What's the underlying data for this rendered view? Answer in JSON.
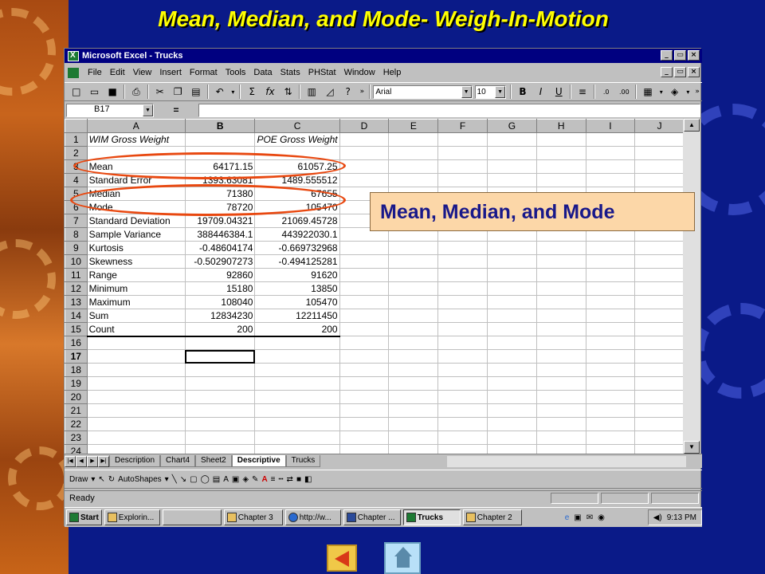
{
  "slide": {
    "title": "Mean, Median, and Mode- Weigh-In-Motion",
    "callout_text": "Mean, Median, and Mode"
  },
  "window": {
    "title": "Microsoft Excel - Trucks",
    "controls": [
      "_",
      "▭",
      "×"
    ]
  },
  "menu": {
    "items": [
      "File",
      "Edit",
      "View",
      "Insert",
      "Format",
      "Tools",
      "Data",
      "Stats",
      "PHStat",
      "Window",
      "Help"
    ]
  },
  "toolbar": {
    "font_name": "Arial",
    "font_size": "10"
  },
  "formula_bar": {
    "cell_ref": "B17",
    "equals": "=",
    "value": ""
  },
  "sheet": {
    "columns": [
      "A",
      "B",
      "C",
      "D",
      "E",
      "F",
      "G",
      "H",
      "I",
      "J"
    ],
    "header_row": [
      "WIM Gross Weight",
      "",
      "POE Gross Weight"
    ],
    "rows": [
      {
        "n": "1",
        "a": "WIM Gross Weight",
        "b": "",
        "c": "POE Gross Weight"
      },
      {
        "n": "2",
        "a": "",
        "b": "",
        "c": ""
      },
      {
        "n": "3",
        "a": "Mean",
        "b": "64171.15",
        "c": "61057.25"
      },
      {
        "n": "4",
        "a": "Standard Error",
        "b": "1393.63081",
        "c": "1489.555512"
      },
      {
        "n": "5",
        "a": "Median",
        "b": "71380",
        "c": "67655"
      },
      {
        "n": "6",
        "a": "Mode",
        "b": "78720",
        "c": "105470"
      },
      {
        "n": "7",
        "a": "Standard Deviation",
        "b": "19709.04321",
        "c": "21069.45728"
      },
      {
        "n": "8",
        "a": "Sample Variance",
        "b": "388446384.1",
        "c": "443922030.1"
      },
      {
        "n": "9",
        "a": "Kurtosis",
        "b": "-0.48604174",
        "c": "-0.669732968"
      },
      {
        "n": "10",
        "a": "Skewness",
        "b": "-0.502907273",
        "c": "-0.494125281"
      },
      {
        "n": "11",
        "a": "Range",
        "b": "92860",
        "c": "91620"
      },
      {
        "n": "12",
        "a": "Minimum",
        "b": "15180",
        "c": "13850"
      },
      {
        "n": "13",
        "a": "Maximum",
        "b": "108040",
        "c": "105470"
      },
      {
        "n": "14",
        "a": "Sum",
        "b": "12834230",
        "c": "12211450"
      },
      {
        "n": "15",
        "a": "Count",
        "b": "200",
        "c": "200"
      },
      {
        "n": "16",
        "a": "",
        "b": "",
        "c": ""
      },
      {
        "n": "17",
        "a": "",
        "b": "",
        "c": ""
      },
      {
        "n": "18",
        "a": "",
        "b": "",
        "c": ""
      },
      {
        "n": "19",
        "a": "",
        "b": "",
        "c": ""
      },
      {
        "n": "20",
        "a": "",
        "b": "",
        "c": ""
      },
      {
        "n": "21",
        "a": "",
        "b": "",
        "c": ""
      },
      {
        "n": "22",
        "a": "",
        "b": "",
        "c": ""
      },
      {
        "n": "23",
        "a": "",
        "b": "",
        "c": ""
      },
      {
        "n": "24",
        "a": "",
        "b": "",
        "c": ""
      }
    ],
    "tabs": [
      "Description",
      "Chart4",
      "Sheet2",
      "Descriptive",
      "Trucks"
    ],
    "active_tab": "Descriptive"
  },
  "drawing": {
    "draw_label": "Draw",
    "autoshapes_label": "AutoShapes"
  },
  "status": {
    "text": "Ready"
  },
  "taskbar": {
    "start_label": "Start",
    "tasks": [
      "Explorin...",
      "",
      "Chapter 3",
      "http://w...",
      "Chapter ...",
      "Trucks",
      "Chapter 2"
    ],
    "active_task": "Trucks",
    "clock": "9:13 PM"
  },
  "colors": {
    "title_yellow": "#ffff00",
    "ellipse": "#e84810",
    "callout_bg": "#fcd7a8",
    "callout_text": "#18188a",
    "titlebar": "#000080"
  }
}
